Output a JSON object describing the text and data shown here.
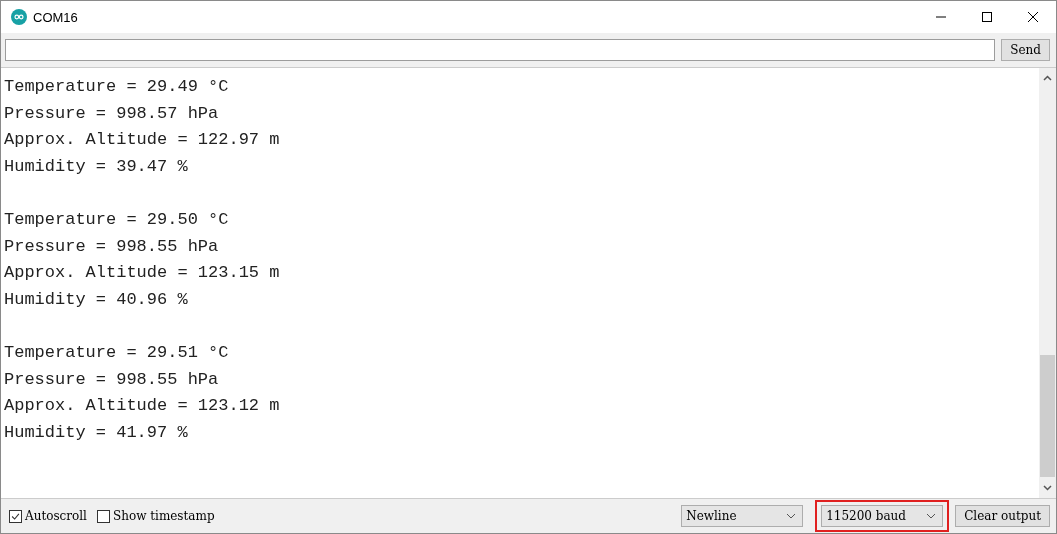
{
  "window": {
    "title": "COM16"
  },
  "send_button": "Send",
  "output": [
    {
      "lines": [
        "Temperature = 29.49 °C",
        "Pressure = 998.57 hPa",
        "Approx. Altitude = 122.97 m",
        "Humidity = 39.47 %"
      ]
    },
    {
      "lines": [
        "Temperature = 29.50 °C",
        "Pressure = 998.55 hPa",
        "Approx. Altitude = 123.15 m",
        "Humidity = 40.96 %"
      ]
    },
    {
      "lines": [
        "Temperature = 29.51 °C",
        "Pressure = 998.55 hPa",
        "Approx. Altitude = 123.12 m",
        "Humidity = 41.97 %"
      ]
    }
  ],
  "options": [
    {
      "label": "Autoscroll",
      "checked": true
    },
    {
      "label": "Show timestamp",
      "checked": false
    }
  ],
  "line_ending": {
    "value": "Newline",
    "highlighted": false
  },
  "baud_rate": {
    "value": "115200 baud",
    "highlighted": true
  },
  "clear_button": "Clear output"
}
